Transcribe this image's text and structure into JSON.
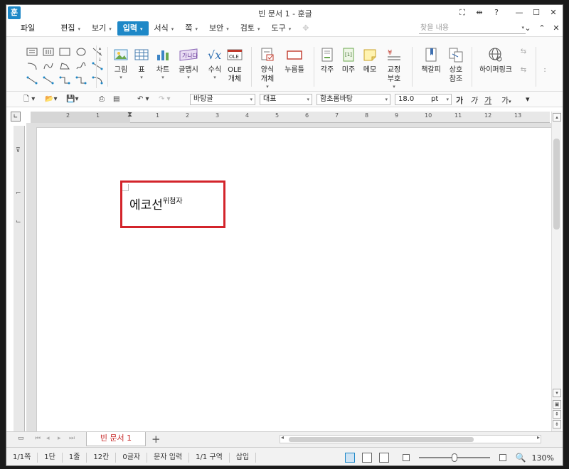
{
  "window": {
    "title": "빈 문서 1 - 훈글",
    "app_icon": "훈"
  },
  "title_buttons": {
    "fullscreen": "⛶",
    "split": "⇹",
    "help": "?",
    "minimize": "—",
    "maximize": "☐",
    "close": "✕"
  },
  "menu": {
    "file": "파일",
    "items": [
      {
        "label": "편집"
      },
      {
        "label": "보기"
      },
      {
        "label": "입력",
        "active": true
      },
      {
        "label": "서식"
      },
      {
        "label": "쪽"
      },
      {
        "label": "보안"
      },
      {
        "label": "검토"
      },
      {
        "label": "도구"
      }
    ],
    "search_placeholder": "찾을 내용",
    "right": [
      "⌄",
      "⌃",
      "✕"
    ]
  },
  "ribbon": {
    "buttons": [
      {
        "name": "picture",
        "label": "그림",
        "sub": "▾"
      },
      {
        "name": "table",
        "label": "표",
        "sub": "▾"
      },
      {
        "name": "chart",
        "label": "차트",
        "sub": "▾"
      },
      {
        "name": "wordart",
        "label": "글맵시",
        "sub": "▾"
      },
      {
        "name": "equation",
        "label": "수식",
        "sub": "▾"
      },
      {
        "name": "ole",
        "label": "OLE\n개체",
        "sub": ""
      },
      {
        "name": "form-object",
        "label": "양식\n개체",
        "sub": "▾"
      },
      {
        "name": "click-here",
        "label": "누름틀",
        "sub": ""
      },
      {
        "name": "footnote",
        "label": "각주",
        "sub": ""
      },
      {
        "name": "endnote",
        "label": "미주",
        "sub": ""
      },
      {
        "name": "memo",
        "label": "메모",
        "sub": ""
      },
      {
        "name": "proofread",
        "label": "교정\n부호",
        "sub": "▾"
      },
      {
        "name": "bookmark",
        "label": "책갈피",
        "sub": ""
      },
      {
        "name": "cross-ref",
        "label": "상호\n참조",
        "sub": ""
      },
      {
        "name": "hyperlink",
        "label": "하이퍼링크",
        "sub": ""
      }
    ]
  },
  "toolbar2": {
    "style": "바탕글",
    "lang": "대표",
    "font": "함초롬바탕",
    "size": "18.0",
    "unit": "pt",
    "fmt": [
      "가",
      "가",
      "가",
      "가"
    ]
  },
  "ruler": {
    "marks": [
      "2",
      "1",
      "1",
      "2",
      "3",
      "4",
      "5",
      "6",
      "7",
      "8",
      "9",
      "10",
      "11",
      "12",
      "13"
    ]
  },
  "document": {
    "text": "에코선",
    "superscript": "위첨자"
  },
  "tabs": {
    "doc_tab": "빈 문서 1",
    "add": "+"
  },
  "status": {
    "items": [
      "1/1쪽",
      "1단",
      "1줄",
      "12칸",
      "0글자",
      "문자 입력",
      "1/1 구역",
      "삽입"
    ],
    "zoom": "130%"
  },
  "colors": {
    "accent": "#1e88c7",
    "highlight": "#d3242b",
    "tab_text": "#c62828"
  }
}
